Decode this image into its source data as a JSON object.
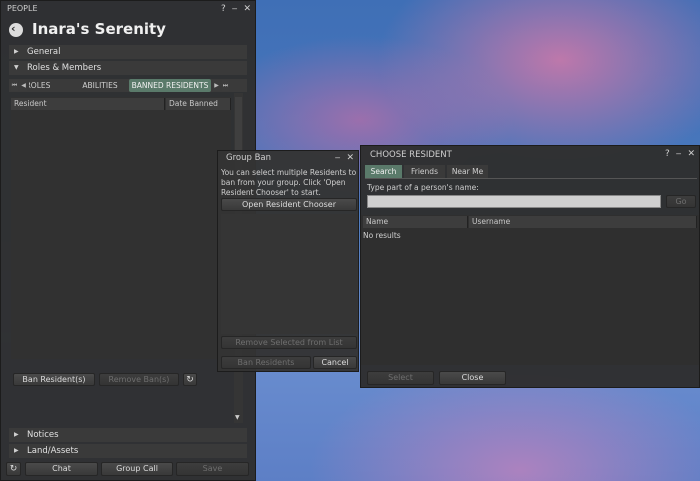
{
  "people": {
    "window_title": "PEOPLE",
    "group_name": "Inara's Serenity",
    "sections": [
      "General",
      "Roles & Members"
    ],
    "tabs": [
      "ROLES",
      "ABILITIES",
      "BANNED RESIDENTS"
    ],
    "columns": [
      "Resident",
      "Date Banned"
    ],
    "ban_button": "Ban Resident(s)",
    "remove_ban_button": "Remove Ban(s)",
    "bottom_sections": [
      "Notices",
      "Land/Assets"
    ],
    "footer_buttons": [
      "Chat",
      "Group Call",
      "Save"
    ]
  },
  "group_ban": {
    "title": "Group Ban",
    "description": "You can select multiple Residents to ban from your group. Click 'Open Resident Chooser' to start.",
    "open_chooser": "Open Resident Chooser",
    "remove_selected": "Remove Selected from List",
    "ban_residents": "Ban Residents",
    "cancel": "Cancel"
  },
  "choose_resident": {
    "title": "CHOOSE RESIDENT",
    "tabs": [
      "Search",
      "Friends",
      "Near Me"
    ],
    "prompt": "Type part of a person's name:",
    "search_value": "",
    "go_button": "Go",
    "columns": [
      "Name",
      "Username"
    ],
    "no_results": "No results",
    "select_button": "Select",
    "close_button": "Close"
  },
  "icons": {
    "back": "back-arrow-icon",
    "refresh": "refresh-icon",
    "help": "help-icon",
    "minimize": "minimize-icon",
    "close": "close-icon"
  },
  "colors": {
    "active_tab": "#5a7a6a",
    "panel_bg": "#2e2e2e"
  }
}
